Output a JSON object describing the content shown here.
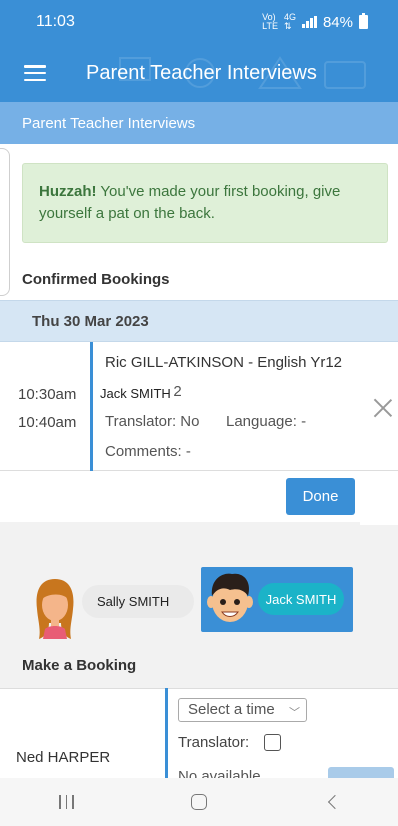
{
  "status_bar": {
    "time": "11:03",
    "network_top": "Vo)",
    "network_bottom": "LTE",
    "network_type": "4G",
    "battery": "84%"
  },
  "app_bar": {
    "title": "Parent Teacher Interviews"
  },
  "sub_header": {
    "title": "Parent Teacher Interviews"
  },
  "alert": {
    "strong": "Huzzah!",
    "message": " You've made your first booking, give yourself a pat on the back."
  },
  "confirmed": {
    "title": "Confirmed Bookings",
    "date": "Thu 30 Mar 2023",
    "booking": {
      "start": "10:30am",
      "end": "10:40am",
      "teacher": "Ric GILL-ATKINSON - English Yr12",
      "room_partial": "'n P2",
      "translator": "Translator: No",
      "language": "Language: -",
      "comments": "Comments: -",
      "student_tag": "Jack SMITH"
    },
    "done_label": "Done"
  },
  "students": {
    "sally": "Sally SMITH",
    "jack": "Jack SMITH"
  },
  "make_booking": {
    "title": "Make a Booking",
    "teacher": "Ned HARPER",
    "select_placeholder": "Select a time",
    "translator_label": "Translator:",
    "no_available": "No available"
  },
  "colors": {
    "primary": "#3a8fd6",
    "accent_teal": "#1bb3c8",
    "success_bg": "#dff0d8",
    "success_text": "#3c763d"
  }
}
